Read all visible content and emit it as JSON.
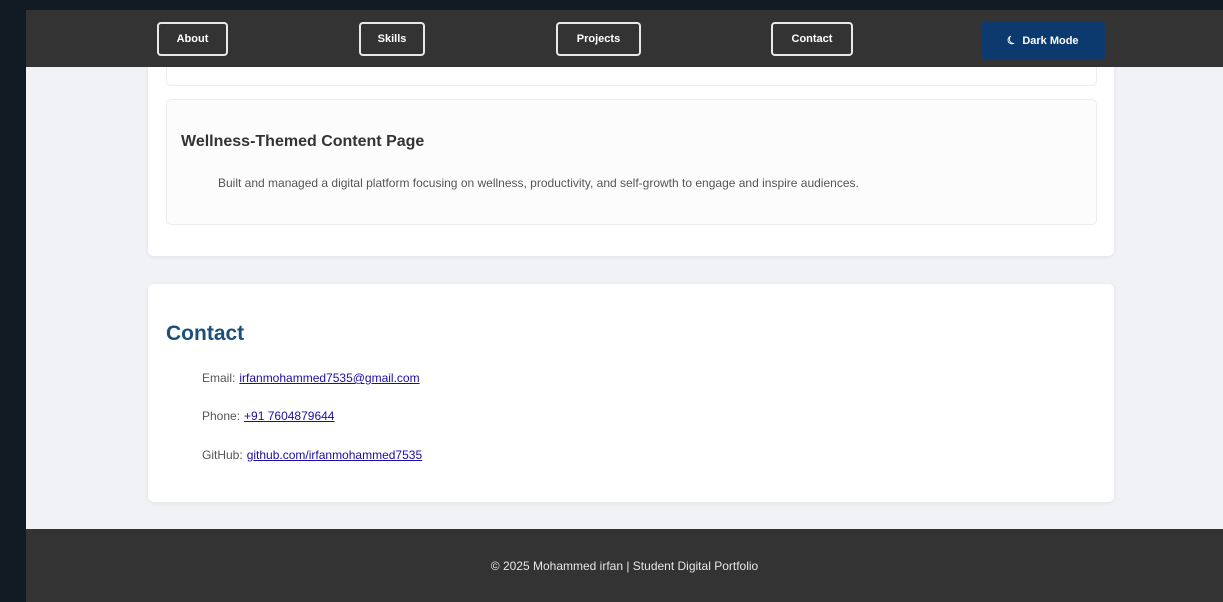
{
  "nav": {
    "items": [
      "About",
      "Skills",
      "Projects",
      "Contact"
    ],
    "dark_mode_label": "Dark Mode",
    "dark_mode_icon": "moon-icon"
  },
  "projects": {
    "current": {
      "title": "Wellness-Themed Content Page",
      "description": "Built and managed a digital platform focusing on wellness, productivity, and self-growth to engage and inspire audiences."
    }
  },
  "contact": {
    "heading": "Contact",
    "email_label": "Email:",
    "email": "irfanmohammed7535@gmail.com",
    "phone_label": "Phone:",
    "phone": "+91 7604879644",
    "github_label": "GitHub:",
    "github": "github.com/irfanmohammed7535"
  },
  "footer": {
    "text": "© 2025 Mohammed irfan | Student Digital Portfolio"
  },
  "colors": {
    "navbar_bg": "#333333",
    "accent": "#0d3a6e",
    "heading": "#1d4f7c",
    "link": "#1a0dab"
  }
}
